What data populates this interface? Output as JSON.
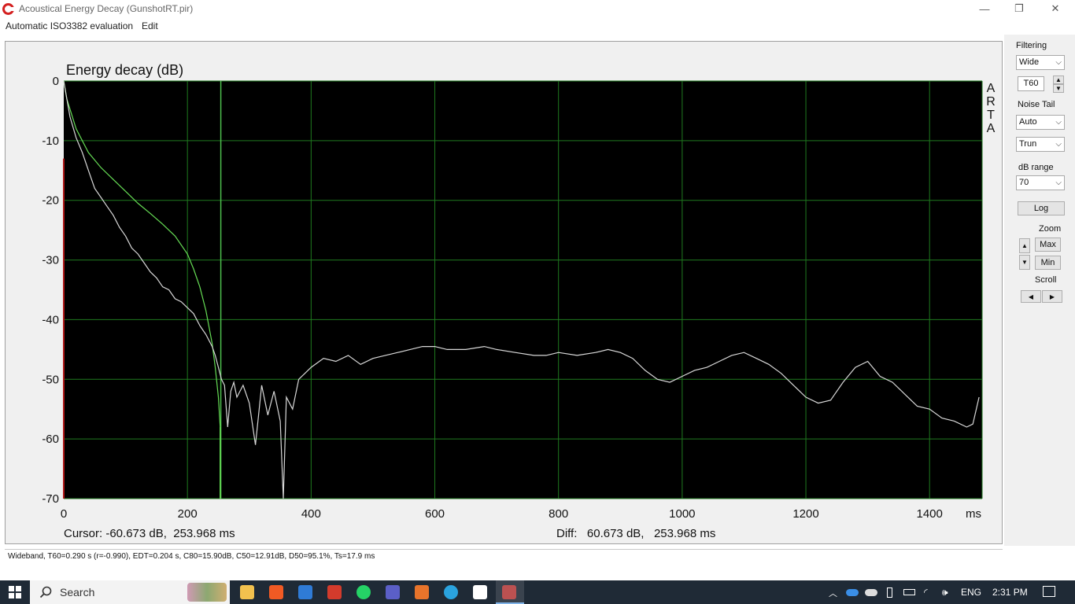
{
  "window": {
    "title": "Acoustical Energy Decay (GunshotRT.pir)",
    "controls": {
      "minimize": "—",
      "restore": "❐",
      "close": "✕"
    }
  },
  "menu": [
    "Automatic ISO3382 evaluation",
    "Edit"
  ],
  "chart_data": {
    "type": "line",
    "title": "Energy decay (dB)",
    "side_label": [
      "A",
      "R",
      "T",
      "A"
    ],
    "xunit": "ms",
    "xlim": [
      0,
      1485
    ],
    "ylim": [
      -70,
      0
    ],
    "xticks": [
      0,
      200,
      400,
      600,
      800,
      1000,
      1200,
      1400
    ],
    "yticks": [
      0,
      -10,
      -20,
      -30,
      -40,
      -50,
      -60,
      -70
    ],
    "grid": true,
    "cursor_x": 253.968,
    "colors": {
      "background": "#000000",
      "grid": "#1f7a1f",
      "schroeder": "#66dd55",
      "energy": "#d8d8d8",
      "cursor": "#4ec04e",
      "marker": "#b01818"
    },
    "series": [
      {
        "x": [
          0,
          5,
          20,
          40,
          60,
          80,
          100,
          120,
          140,
          160,
          180,
          200,
          210,
          220,
          230,
          240,
          245,
          250,
          253
        ],
        "y": [
          0,
          -3,
          -8,
          -12,
          -14.5,
          -16.5,
          -18.5,
          -20.5,
          -22.2,
          -24,
          -26,
          -29,
          -31.5,
          -34.5,
          -38.5,
          -44,
          -48,
          -53,
          -58
        ]
      },
      {
        "x": [
          0,
          10,
          20,
          30,
          40,
          50,
          60,
          70,
          80,
          90,
          100,
          110,
          120,
          130,
          140,
          150,
          160,
          170,
          180,
          190,
          200,
          210,
          220,
          230,
          240,
          245,
          250,
          255,
          260,
          265,
          270,
          275,
          280,
          290,
          300,
          310,
          320,
          330,
          340,
          350,
          355,
          360,
          370,
          380,
          390,
          400,
          420,
          440,
          460,
          480,
          500,
          520,
          540,
          560,
          580,
          600,
          620,
          650,
          680,
          700,
          730,
          760,
          780,
          800,
          830,
          860,
          880,
          900,
          920,
          940,
          960,
          980,
          1000,
          1020,
          1040,
          1060,
          1080,
          1100,
          1120,
          1140,
          1160,
          1180,
          1200,
          1220,
          1240,
          1260,
          1280,
          1300,
          1320,
          1340,
          1360,
          1380,
          1400,
          1420,
          1440,
          1460,
          1470,
          1480
        ],
        "y": [
          0,
          -6,
          -9.5,
          -12,
          -15,
          -18,
          -19.5,
          -21,
          -22.5,
          -24.5,
          -26,
          -28,
          -29,
          -30.5,
          -32,
          -33,
          -34.5,
          -35,
          -36.5,
          -37,
          -38,
          -39,
          -41,
          -42.5,
          -44.5,
          -46,
          -48,
          -50,
          -51,
          -58,
          -52,
          -50.5,
          -53,
          -51,
          -54,
          -61,
          -51,
          -56,
          -52,
          -57,
          -70,
          -53,
          -55,
          -50,
          -49,
          -48,
          -46.5,
          -47,
          -46,
          -47.5,
          -46.5,
          -46,
          -45.5,
          -45,
          -44.5,
          -44.5,
          -45,
          -45,
          -44.5,
          -45,
          -45.5,
          -46,
          -46,
          -45.5,
          -46,
          -45.5,
          -45,
          -45.5,
          -46.5,
          -48.5,
          -50,
          -50.5,
          -49.5,
          -48.5,
          -48,
          -47,
          -46,
          -45.5,
          -46.5,
          -47.5,
          -49,
          -51,
          -53,
          -54,
          -53.5,
          -50.5,
          -48,
          -47,
          -49.5,
          -50.5,
          -52.5,
          -54.5,
          -55,
          -56.5,
          -57,
          -58,
          -57.5,
          -53
        ]
      }
    ]
  },
  "readouts": {
    "cursor": "Cursor: -60.673 dB,  253.968 ms",
    "diff": "Diff:   60.673 dB,   253.968 ms"
  },
  "panel": {
    "filtering_label": "Filtering",
    "filter_value": "Wide",
    "param_value": "T60",
    "noise_tail_label": "Noise Tail",
    "noise_tail_value": "Auto",
    "trunc_value": "Trun",
    "db_range_label": "dB range",
    "db_range_value": "70",
    "log_label": "Log",
    "zoom_label": "Zoom",
    "zoom_max": "Max",
    "zoom_min": "Min",
    "scroll_label": "Scroll",
    "up": "▲",
    "down": "▼",
    "left": "◀",
    "right": "▶"
  },
  "status": "Wideband, T60=0.290 s (r=-0.990), EDT=0.204 s, C80=15.90dB, C50=12.91dB, D50=95.1%, Ts=17.9  ms",
  "taskbar": {
    "search_label": "Search",
    "language": "ENG",
    "time": "2:31 PM",
    "apps": [
      "file-explorer",
      "brave",
      "todo",
      "arta-1",
      "whatsapp",
      "teams",
      "office",
      "telegram",
      "arta-2",
      "arta-3"
    ]
  }
}
